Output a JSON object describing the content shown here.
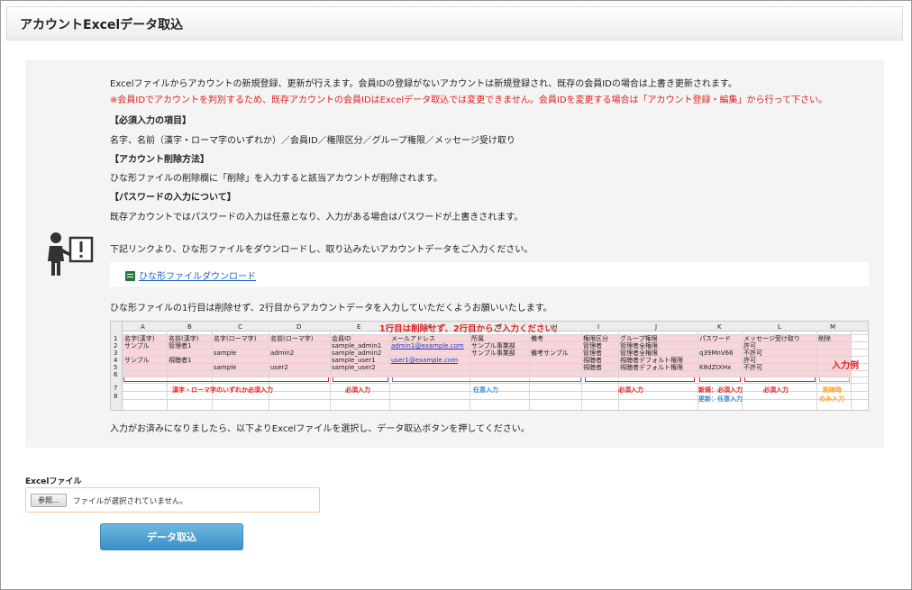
{
  "header": {
    "title": "アカウントExcelデータ取込"
  },
  "colors": {
    "accent_red": "#e02020",
    "link_blue": "#1a63c6",
    "button_blue": "#3b8fc8"
  },
  "intro": {
    "line1": "Excelファイルからアカウントの新規登録、更新が行えます。会員IDの登録がないアカウントは新規登録され、既存の会員IDの場合は上書き更新されます。",
    "line2": "※会員IDでアカウントを判別するため、既存アカウントの会員IDはExcelデータ取込では変更できません。会員IDを変更する場合は「アカウント登録・編集」から行って下さい。"
  },
  "required": {
    "heading": "【必須入力の項目】",
    "text": "名字、名前（漢字・ローマ字のいずれか）／会員ID／権限区分／グループ権限／メッセージ受け取り"
  },
  "delete": {
    "heading": "【アカウント削除方法】",
    "text": "ひな形ファイルの削除欄に「削除」を入力すると該当アカウントが削除されます。"
  },
  "password": {
    "heading": "【パスワードの入力について】",
    "text": "既存アカウントではパスワードの入力は任意となり、入力がある場合はパスワードが上書きされます。"
  },
  "download": {
    "instruction": "下記リンクより、ひな形ファイルをダウンロードし、取り込みたいアカウントデータをご入力ください。",
    "link_label": "ひな形ファイルダウンロード",
    "icon": "excel-file-icon"
  },
  "template_note": "ひな形ファイルの1行目は削除せず、2行目からアカウントデータを入力していただくようお願いいたします。",
  "sheet": {
    "banner": "1行目は削除せず、2行目からご入力ください。",
    "input_example": "入力例",
    "column_letters": [
      "A",
      "B",
      "C",
      "D",
      "E",
      "F",
      "G",
      "H",
      "I",
      "J",
      "K",
      "L",
      "M"
    ],
    "row_numbers": [
      "1",
      "2",
      "3",
      "4",
      "5",
      "6",
      "7",
      "8"
    ],
    "headers": [
      "名字(漢字)",
      "名前(漢字)",
      "名字(ローマ字)",
      "名前(ローマ字)",
      "会員ID",
      "メールアドレス",
      "所属",
      "備考",
      "権限区分",
      "グループ権限",
      "パスワード",
      "メッセージ受け取り",
      "削除"
    ],
    "rows": [
      [
        "サンプル",
        "管理者1",
        "",
        "",
        "sample_admin1",
        "admin1@example.com",
        "サンプル事業部",
        "",
        "管理者",
        "管理者全権限",
        "",
        "許可",
        ""
      ],
      [
        "",
        "",
        "sample",
        "admin2",
        "sample_admin2",
        "",
        "サンプル事業部",
        "備考サンプル",
        "管理者",
        "管理者全権限",
        "q39MnV66",
        "不許可",
        ""
      ],
      [
        "サンプル",
        "視聴者1",
        "",
        "",
        "sample_user1",
        "user1@example.com",
        "",
        "",
        "視聴者",
        "視聴者デフォルト権限",
        "",
        "許可",
        ""
      ],
      [
        "",
        "",
        "sample",
        "user2",
        "sample_user2",
        "",
        "",
        "",
        "視聴者",
        "視聴者デフォルト権限",
        "K8dZtXHx",
        "不許可",
        ""
      ]
    ],
    "labels": {
      "name_required": "漢字・ローマ字のいずれか必須入力",
      "id_required": "必須入力",
      "optional": "任意入力",
      "group_required": "必須入力",
      "password_new": "新規：必須入力",
      "password_update": "更新：任意入力",
      "message_required": "必須入力",
      "delete_only_1": "削除時",
      "delete_only_2": "のみ入力"
    }
  },
  "after_input": "入力がお済みになりましたら、以下よりExcelファイルを選択し、データ取込ボタンを押してください。",
  "file": {
    "label": "Excelファイル",
    "browse_label": "参照...",
    "status": "ファイルが選択されていません。"
  },
  "import_button": "データ取込"
}
